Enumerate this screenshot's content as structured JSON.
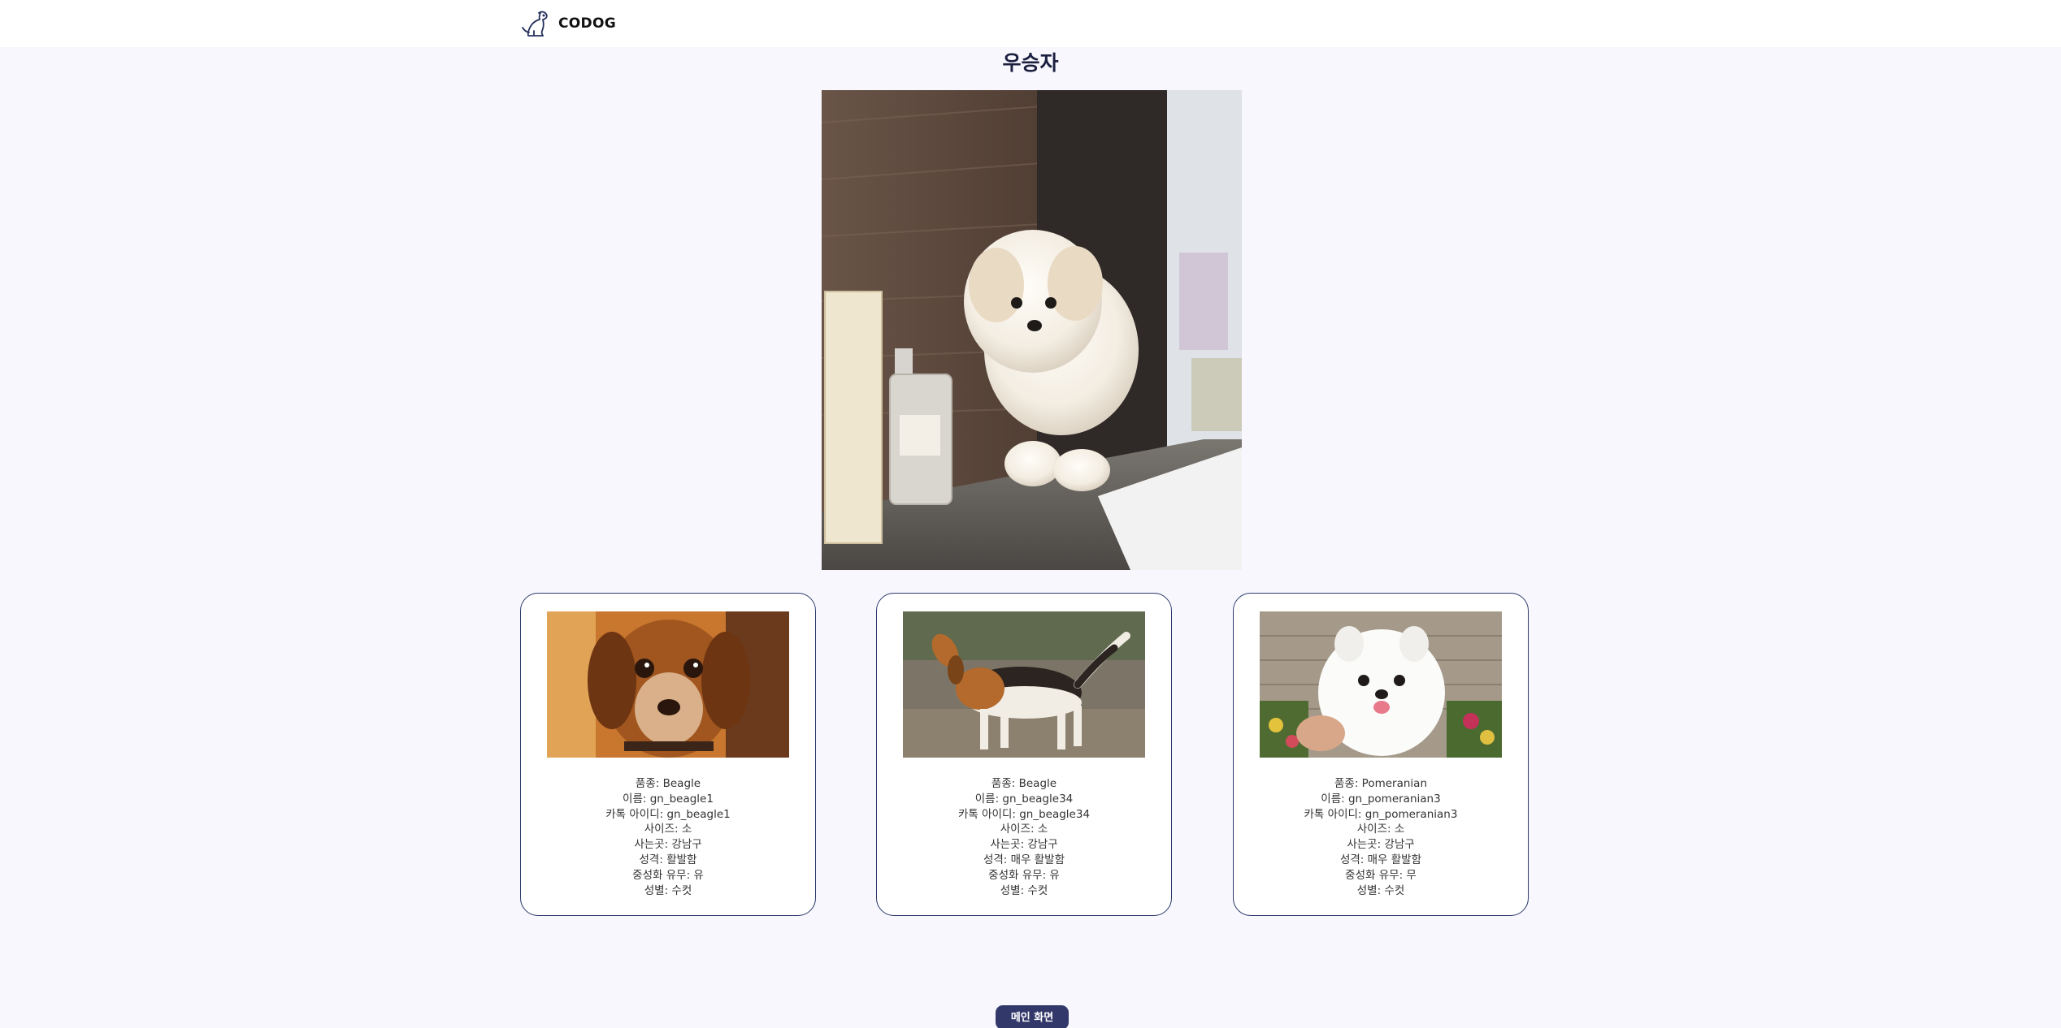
{
  "header": {
    "brand_name": "CODOG",
    "logo_icon": "dog-sitting-icon"
  },
  "page": {
    "title": "우승자"
  },
  "winner": {
    "photo_description_icon": "white-puppy-photo"
  },
  "cards": [
    {
      "photo_icon": "beagle-face-photo",
      "breed": "품종: Beagle",
      "name": "이름: gn_beagle1",
      "kakao_id": "카톡 아이디: gn_beagle1",
      "size": "사이즈: 소",
      "location": "사는곳: 강남구",
      "personality": "성격: 활발함",
      "neutered": "중성화 유무: 유",
      "gender": "성별: 수컷"
    },
    {
      "photo_icon": "beagle-standing-photo",
      "breed": "품종: Beagle",
      "name": "이름: gn_beagle34",
      "kakao_id": "카톡 아이디: gn_beagle34",
      "size": "사이즈: 소",
      "location": "사는곳: 강남구",
      "personality": "성격: 매우 활발함",
      "neutered": "중성화 유무: 유",
      "gender": "성별: 수컷"
    },
    {
      "photo_icon": "pomeranian-photo",
      "breed": "품종: Pomeranian",
      "name": "이름: gn_pomeranian3",
      "kakao_id": "카톡 아이디: gn_pomeranian3",
      "size": "사이즈: 소",
      "location": "사는곳: 강남구",
      "personality": "성격: 매우 활발함",
      "neutered": "중성화 유무: 무",
      "gender": "성별: 수컷"
    }
  ],
  "footer": {
    "main_button_label": "메인 화면"
  },
  "colors": {
    "background": "#f7f7fd",
    "accent": "#33386a",
    "card_border": "#2c3a6b"
  }
}
